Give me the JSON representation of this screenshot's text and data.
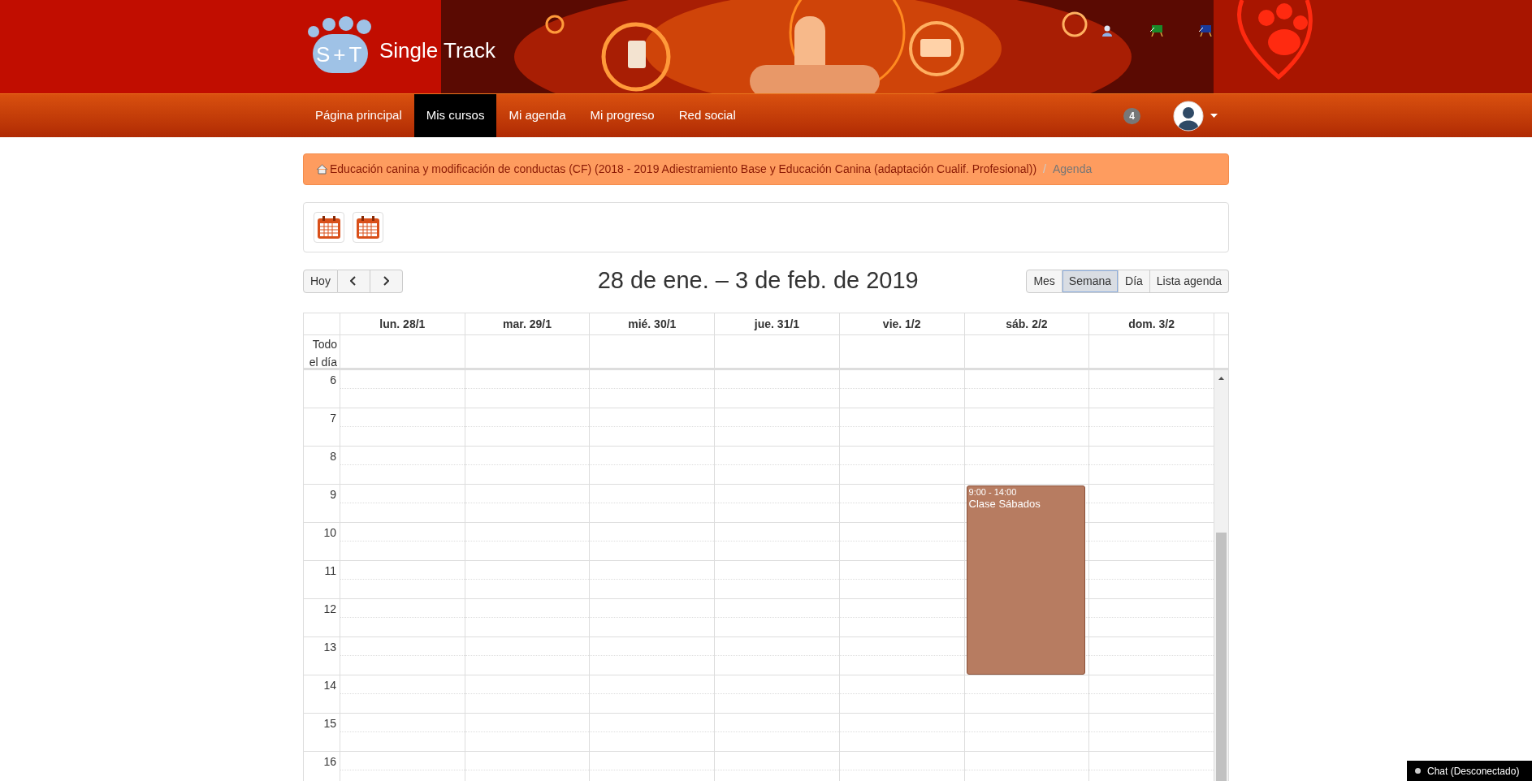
{
  "header": {
    "logo_mark": "S+T",
    "site_name": "Single Track"
  },
  "nav": {
    "items": [
      {
        "label": "Página principal",
        "selected": false
      },
      {
        "label": "Mis cursos",
        "selected": true
      },
      {
        "label": "Mi agenda",
        "selected": false
      },
      {
        "label": "Mi progreso",
        "selected": false
      },
      {
        "label": "Red social",
        "selected": false
      }
    ],
    "badge": "4"
  },
  "breadcrumb": {
    "items": [
      {
        "label": "Educación canina y modificación de conductas (CF) (2018 - 2019 Adiestramiento Base y Educación Canina (adaptación Cualif. Profesional))",
        "kind": "link"
      },
      {
        "label": "Agenda",
        "kind": "current"
      }
    ],
    "separator": "/"
  },
  "calendar": {
    "today_button": "Hoy",
    "title": "28 de ene. – 3 de feb. de 2019",
    "views": [
      {
        "label": "Mes",
        "selected": false
      },
      {
        "label": "Semana",
        "selected": true
      },
      {
        "label": "Día",
        "selected": false
      },
      {
        "label": "Lista agenda",
        "selected": false
      }
    ],
    "all_day_label": "Todo el día",
    "days": [
      {
        "label": "lun. 28/1"
      },
      {
        "label": "mar. 29/1"
      },
      {
        "label": "mié. 30/1"
      },
      {
        "label": "jue. 31/1"
      },
      {
        "label": "vie. 1/2"
      },
      {
        "label": "sáb. 2/2",
        "events": [
          {
            "time": "9:00 - 14:00",
            "title": "Clase Sábados",
            "color": "#b77c61"
          }
        ]
      },
      {
        "label": "dom. 3/2"
      }
    ],
    "hours": [
      "6",
      "7",
      "8",
      "9",
      "10",
      "11",
      "12",
      "13",
      "14",
      "15",
      "16"
    ]
  },
  "chat": {
    "label": "Chat (Desconectado)"
  }
}
